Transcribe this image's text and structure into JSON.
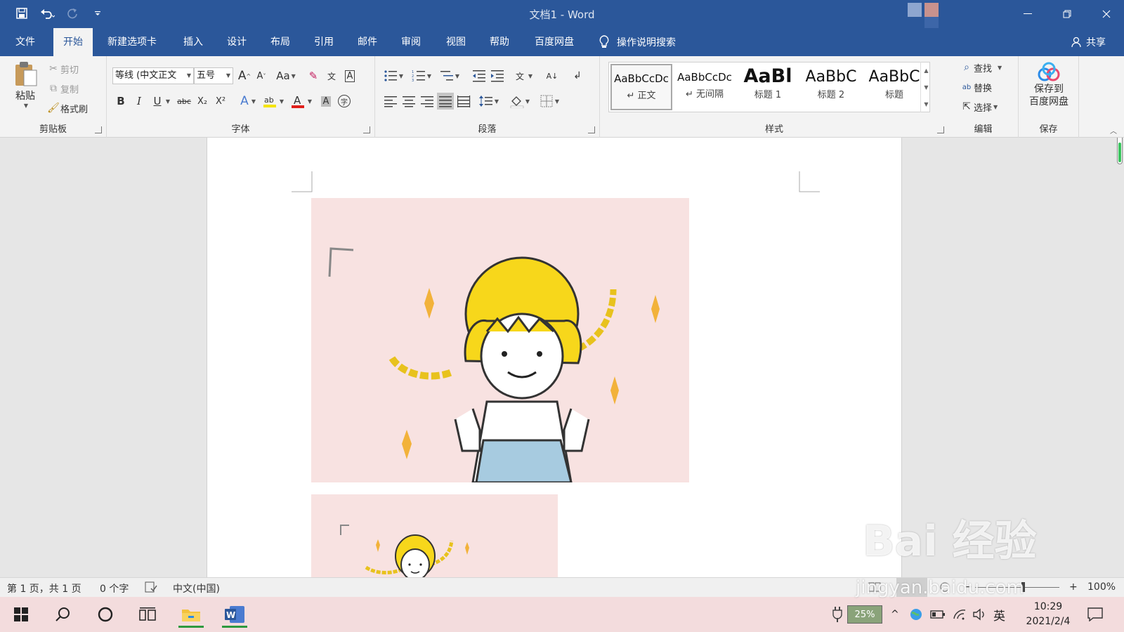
{
  "window": {
    "title": "文档1  -  Word",
    "accent": "#2b579a"
  },
  "tabs": [
    {
      "label": "文件"
    },
    {
      "label": "开始",
      "active": true
    },
    {
      "label": "新建选项卡"
    },
    {
      "label": "插入"
    },
    {
      "label": "设计"
    },
    {
      "label": "布局"
    },
    {
      "label": "引用"
    },
    {
      "label": "邮件"
    },
    {
      "label": "审阅"
    },
    {
      "label": "视图"
    },
    {
      "label": "帮助"
    },
    {
      "label": "百度网盘"
    }
  ],
  "tell_me": "操作说明搜索",
  "share": "共享",
  "clipboard": {
    "paste": "粘贴",
    "cut": "剪切",
    "copy": "复制",
    "format_painter": "格式刷",
    "label": "剪贴板"
  },
  "font": {
    "name": "等线 (中文正文",
    "size": "五号",
    "label": "字体",
    "bold": "B",
    "italic": "I",
    "underline": "U",
    "strike": "abc",
    "sub": "X₂",
    "sup": "X²",
    "grow": "A",
    "shrink": "A",
    "case": "Aa",
    "highlight_color": "#f5e400",
    "font_color": "#e0201b"
  },
  "paragraph": {
    "label": "段落"
  },
  "styles": {
    "label": "样式",
    "items": [
      {
        "sample": "AaBbCcDc",
        "name": "↵ 正文"
      },
      {
        "sample": "AaBbCcDc",
        "name": "↵ 无间隔"
      },
      {
        "sample": "AaBl",
        "name": "标题 1"
      },
      {
        "sample": "AaBbC",
        "name": "标题 2"
      },
      {
        "sample": "AaBbC",
        "name": "标题"
      }
    ]
  },
  "editing": {
    "find": "查找",
    "replace": "替换",
    "select": "选择",
    "label": "编辑"
  },
  "save_group": {
    "button": "保存到\n百度网盘",
    "label": "保存"
  },
  "status": {
    "page": "第 1 页，共 1 页",
    "words": "0 个字",
    "language": "中文(中国)",
    "zoom": "100%"
  },
  "taskbar": {
    "battery": "25%",
    "ime": "英",
    "time": "10:29",
    "date": "2021/2/4"
  },
  "watermark": {
    "main": "Bai 经验",
    "sub": "jingyan.baidu.com"
  }
}
